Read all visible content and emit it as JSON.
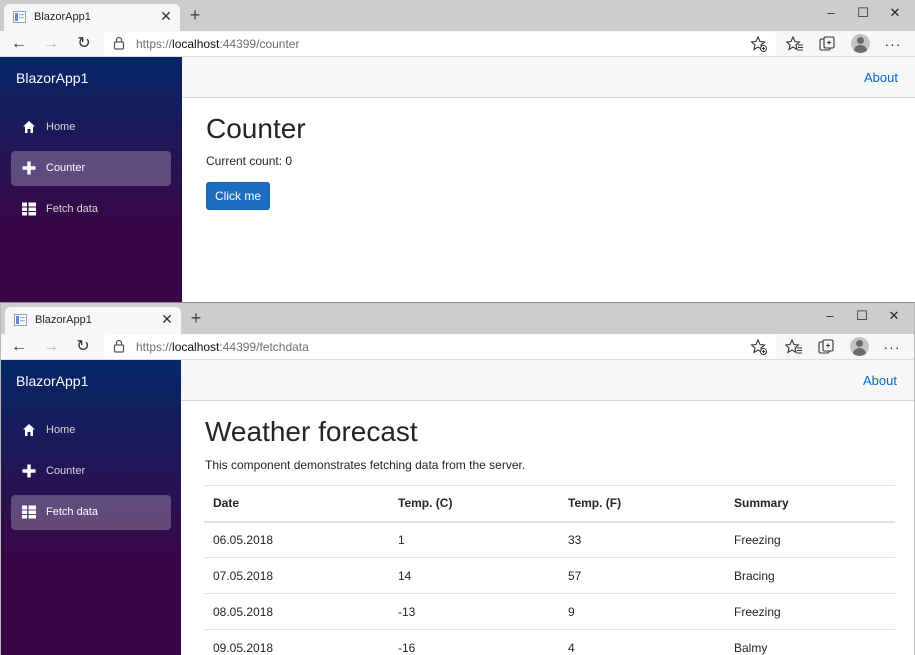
{
  "counter_window": {
    "tab_title": "BlazorApp1",
    "url": {
      "scheme": "https://",
      "host": "localhost",
      "port": ":44399",
      "path": "/counter"
    },
    "brand": "BlazorApp1",
    "nav": [
      {
        "label": "Home",
        "icon": "home-icon",
        "active": false
      },
      {
        "label": "Counter",
        "icon": "plus-icon",
        "active": true
      },
      {
        "label": "Fetch data",
        "icon": "list-icon",
        "active": false
      }
    ],
    "about": "About",
    "page": {
      "title": "Counter",
      "count_text": "Current count: 0",
      "button_label": "Click me"
    }
  },
  "fetchdata_window": {
    "tab_title": "BlazorApp1",
    "url": {
      "scheme": "https://",
      "host": "localhost",
      "port": ":44399",
      "path": "/fetchdata"
    },
    "brand": "BlazorApp1",
    "nav": [
      {
        "label": "Home",
        "icon": "home-icon",
        "active": false
      },
      {
        "label": "Counter",
        "icon": "plus-icon",
        "active": false
      },
      {
        "label": "Fetch data",
        "icon": "list-icon",
        "active": true
      }
    ],
    "about": "About",
    "page": {
      "title": "Weather forecast",
      "description": "This component demonstrates fetching data from the server.",
      "table": {
        "headers": [
          "Date",
          "Temp. (C)",
          "Temp. (F)",
          "Summary"
        ],
        "rows": [
          [
            "06.05.2018",
            "1",
            "33",
            "Freezing"
          ],
          [
            "07.05.2018",
            "14",
            "57",
            "Bracing"
          ],
          [
            "08.05.2018",
            "-13",
            "9",
            "Freezing"
          ],
          [
            "09.05.2018",
            "-16",
            "4",
            "Balmy"
          ]
        ]
      }
    }
  },
  "window_controls": {
    "minimize": "–",
    "maximize": "☐",
    "close": "✕"
  },
  "colors": {
    "sidebar_top": "#052767",
    "sidebar_bottom": "#3a0647",
    "button": "#1b6ec2",
    "link": "#0366d6"
  }
}
